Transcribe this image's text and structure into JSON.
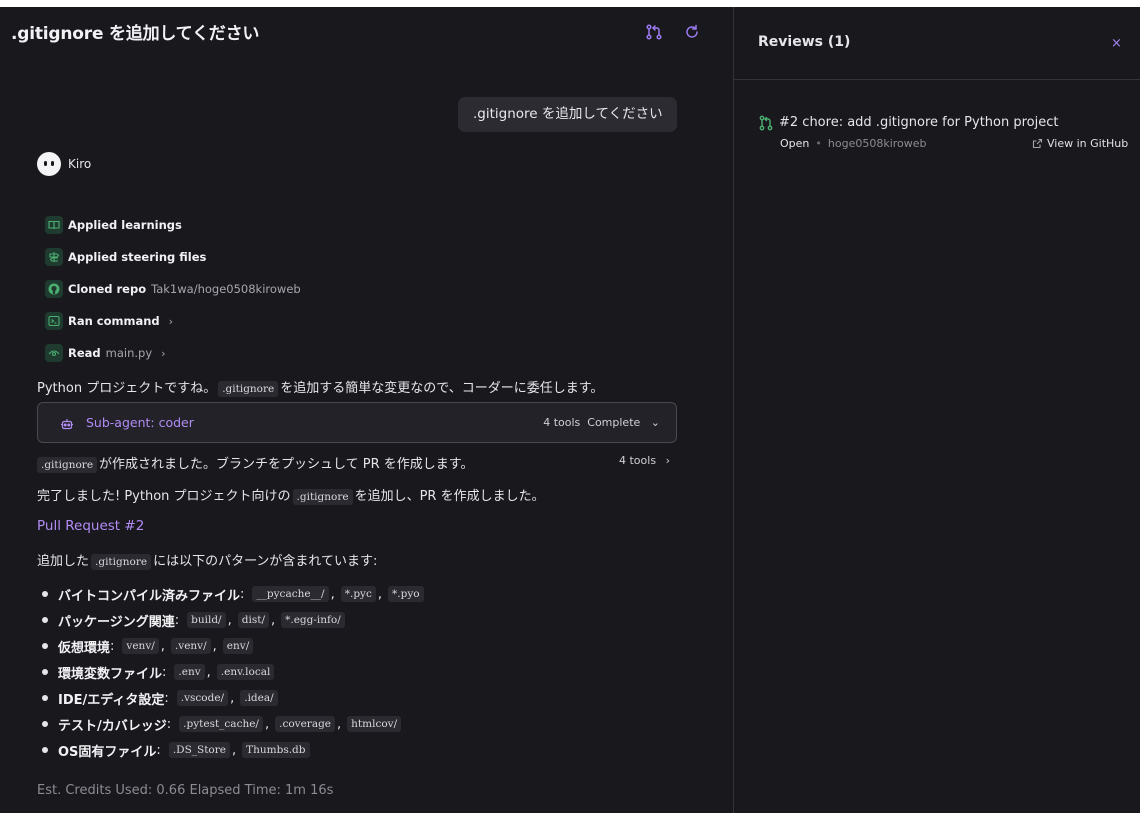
{
  "header": {
    "title": ".gitignore を追加してください"
  },
  "conversation": {
    "user_message": ".gitignore を追加してください",
    "agent_name": "Kiro",
    "steps": [
      {
        "label": "Applied learnings",
        "detail": "",
        "icon": "book-icon"
      },
      {
        "label": "Applied steering files",
        "detail": "",
        "icon": "signpost-icon"
      },
      {
        "label": "Cloned repo",
        "detail": "Tak1wa/hoge0508kiroweb",
        "icon": "github-icon"
      },
      {
        "label": "Ran command",
        "detail": "",
        "icon": "terminal-icon"
      },
      {
        "label": "Read",
        "detail": "main.py",
        "icon": "eye-icon"
      }
    ],
    "para1": {
      "before": "Python プロジェクトですね。",
      "code": ".gitignore",
      "after": "を追加する簡単な変更なので、コーダーに委任します。"
    },
    "subagent": {
      "label": "Sub-agent: coder",
      "tools": "4 tools",
      "status": "Complete"
    },
    "para2": {
      "code": ".gitignore",
      "after": "が作成されました。ブランチをプッシュして PR を作成します。",
      "tools": "4 tools"
    },
    "para3": {
      "before": "完了しました! Python プロジェクト向けの",
      "code": ".gitignore",
      "after": "を追加し、PR を作成しました。"
    },
    "pr_link": "Pull Request #2",
    "para4": {
      "before": "追加した",
      "code": ".gitignore",
      "after": "には以下のパターンが含まれています:"
    },
    "patterns": [
      {
        "label": "バイトコンパイル済みファイル",
        "codes": [
          "__pycache__/",
          "*.pyc",
          "*.pyo"
        ]
      },
      {
        "label": "パッケージング関連",
        "codes": [
          "build/",
          "dist/",
          "*.egg-info/"
        ]
      },
      {
        "label": "仮想環境",
        "codes": [
          "venv/",
          ".venv/",
          "env/"
        ]
      },
      {
        "label": "環境変数ファイル",
        "codes": [
          ".env",
          ".env.local"
        ]
      },
      {
        "label": "IDE/エディタ設定",
        "codes": [
          ".vscode/",
          ".idea/"
        ]
      },
      {
        "label": "テスト/カバレッジ",
        "codes": [
          ".pytest_cache/",
          ".coverage",
          "htmlcov/"
        ]
      },
      {
        "label": "OS固有ファイル",
        "codes": [
          ".DS_Store",
          "Thumbs.db"
        ]
      }
    ],
    "footer": "Est. Credits Used: 0.66  Elapsed Time: 1m 16s"
  },
  "reviews": {
    "title": "Reviews (1)",
    "close": "×",
    "items": [
      {
        "title": "#2 chore: add .gitignore for Python project",
        "status": "Open",
        "repo": "hoge0508kiroweb",
        "link": "View in GitHub"
      }
    ]
  },
  "colors": {
    "background": "#19181d",
    "accent": "#b18cf5",
    "success": "#4caf72",
    "border": "#34323a"
  }
}
